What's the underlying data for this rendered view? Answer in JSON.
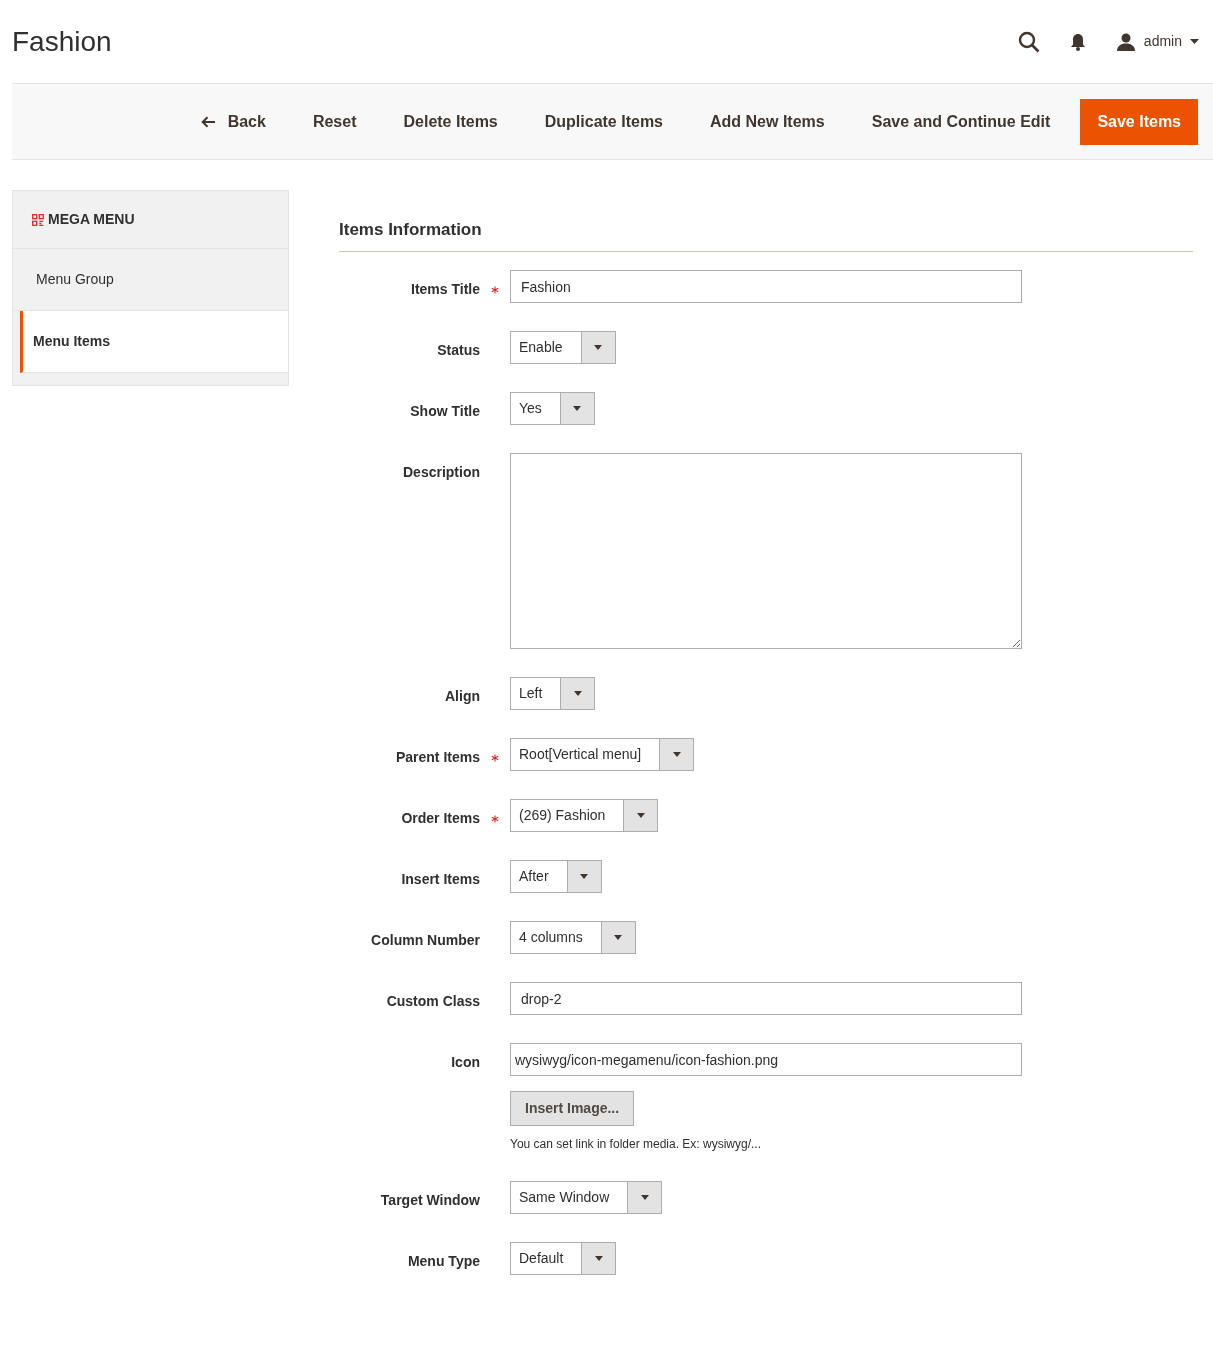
{
  "page": {
    "title": "Fashion",
    "user": "admin"
  },
  "toolbar": {
    "back": "Back",
    "buttons": [
      "Reset",
      "Delete Items",
      "Duplicate Items",
      "Add New Items",
      "Save and Continue Edit"
    ],
    "primary": "Save Items"
  },
  "sidebar": {
    "title": "MEGA MENU",
    "items": [
      {
        "label": "Menu Group",
        "selected": false
      },
      {
        "label": "Menu Items",
        "selected": true
      }
    ]
  },
  "section": {
    "title": "Items Information"
  },
  "fields": [
    {
      "kind": "text",
      "label": "Items Title",
      "required": true,
      "value": "Fashion"
    },
    {
      "kind": "select",
      "label": "Status",
      "required": false,
      "value": "Enable"
    },
    {
      "kind": "select",
      "label": "Show Title",
      "required": false,
      "value": "Yes"
    },
    {
      "kind": "textarea",
      "label": "Description",
      "required": false
    },
    {
      "kind": "select",
      "label": "Align",
      "required": false,
      "value": "Left"
    },
    {
      "kind": "select",
      "label": "Parent Items",
      "required": true,
      "value": "Root[Vertical menu]"
    },
    {
      "kind": "select",
      "label": "Order Items",
      "required": true,
      "value": "(269) Fashion"
    },
    {
      "kind": "select",
      "label": "Insert Items",
      "required": false,
      "value": "After"
    },
    {
      "kind": "select",
      "label": "Column Number",
      "required": false,
      "value": "4 columns"
    },
    {
      "kind": "text",
      "label": "Custom Class",
      "required": false,
      "value": "drop-2"
    },
    {
      "kind": "image",
      "label": "Icon",
      "required": false,
      "value": "wysiwyg/icon-megamenu/icon-fashion.png",
      "button": "Insert Image...",
      "note": "You can set link in folder media. Ex: wysiwyg/..."
    },
    {
      "kind": "select",
      "label": "Target Window",
      "required": false,
      "value": "Same Window"
    },
    {
      "kind": "select",
      "label": "Menu Type",
      "required": false,
      "value": "Default"
    }
  ]
}
